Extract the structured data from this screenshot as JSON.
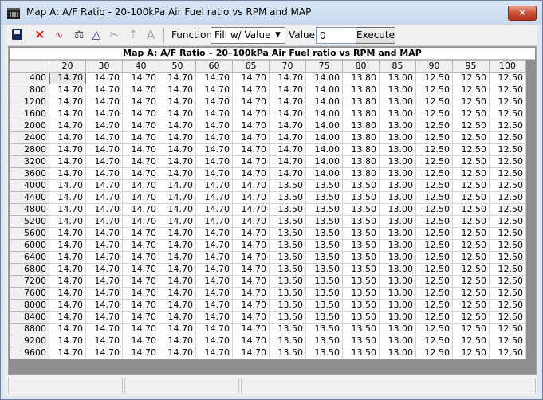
{
  "window": {
    "title": "Map A: A/F Ratio - 20-100kPa Air Fuel ratio vs RPM and MAP",
    "close_label": "✕"
  },
  "toolbar": {
    "function_label": "Function:",
    "function_value": "Fill w/ Value",
    "value_label": "Value:",
    "value_input": "0",
    "execute_label": "Execute"
  },
  "grid": {
    "title": "Map A: A/F Ratio – 20–100kPa Air Fuel ratio vs RPM and MAP",
    "columns": [
      "20",
      "30",
      "40",
      "50",
      "60",
      "65",
      "70",
      "75",
      "80",
      "85",
      "90",
      "95",
      "100"
    ],
    "rows": [
      {
        "rpm": "400",
        "values": [
          "14.70",
          "14.70",
          "14.70",
          "14.70",
          "14.70",
          "14.70",
          "14.70",
          "14.00",
          "13.80",
          "13.00",
          "12.50",
          "12.50",
          "12.50"
        ]
      },
      {
        "rpm": "800",
        "values": [
          "14.70",
          "14.70",
          "14.70",
          "14.70",
          "14.70",
          "14.70",
          "14.70",
          "14.00",
          "13.80",
          "13.00",
          "12.50",
          "12.50",
          "12.50"
        ]
      },
      {
        "rpm": "1200",
        "values": [
          "14.70",
          "14.70",
          "14.70",
          "14.70",
          "14.70",
          "14.70",
          "14.70",
          "14.00",
          "13.80",
          "13.00",
          "12.50",
          "12.50",
          "12.50"
        ]
      },
      {
        "rpm": "1600",
        "values": [
          "14.70",
          "14.70",
          "14.70",
          "14.70",
          "14.70",
          "14.70",
          "14.70",
          "14.00",
          "13.80",
          "13.00",
          "12.50",
          "12.50",
          "12.50"
        ]
      },
      {
        "rpm": "2000",
        "values": [
          "14.70",
          "14.70",
          "14.70",
          "14.70",
          "14.70",
          "14.70",
          "14.70",
          "14.00",
          "13.80",
          "13.00",
          "12.50",
          "12.50",
          "12.50"
        ]
      },
      {
        "rpm": "2400",
        "values": [
          "14.70",
          "14.70",
          "14.70",
          "14.70",
          "14.70",
          "14.70",
          "14.70",
          "14.00",
          "13.80",
          "13.00",
          "12.50",
          "12.50",
          "12.50"
        ]
      },
      {
        "rpm": "2800",
        "values": [
          "14.70",
          "14.70",
          "14.70",
          "14.70",
          "14.70",
          "14.70",
          "14.70",
          "14.00",
          "13.80",
          "13.00",
          "12.50",
          "12.50",
          "12.50"
        ]
      },
      {
        "rpm": "3200",
        "values": [
          "14.70",
          "14.70",
          "14.70",
          "14.70",
          "14.70",
          "14.70",
          "14.70",
          "14.00",
          "13.80",
          "13.00",
          "12.50",
          "12.50",
          "12.50"
        ]
      },
      {
        "rpm": "3600",
        "values": [
          "14.70",
          "14.70",
          "14.70",
          "14.70",
          "14.70",
          "14.70",
          "14.70",
          "14.00",
          "13.80",
          "13.00",
          "12.50",
          "12.50",
          "12.50"
        ]
      },
      {
        "rpm": "4000",
        "values": [
          "14.70",
          "14.70",
          "14.70",
          "14.70",
          "14.70",
          "14.70",
          "13.50",
          "13.50",
          "13.50",
          "13.00",
          "12.50",
          "12.50",
          "12.50"
        ]
      },
      {
        "rpm": "4400",
        "values": [
          "14.70",
          "14.70",
          "14.70",
          "14.70",
          "14.70",
          "14.70",
          "13.50",
          "13.50",
          "13.50",
          "13.00",
          "12.50",
          "12.50",
          "12.50"
        ]
      },
      {
        "rpm": "4800",
        "values": [
          "14.70",
          "14.70",
          "14.70",
          "14.70",
          "14.70",
          "14.70",
          "13.50",
          "13.50",
          "13.50",
          "13.00",
          "12.50",
          "12.50",
          "12.50"
        ]
      },
      {
        "rpm": "5200",
        "values": [
          "14.70",
          "14.70",
          "14.70",
          "14.70",
          "14.70",
          "14.70",
          "13.50",
          "13.50",
          "13.50",
          "13.00",
          "12.50",
          "12.50",
          "12.50"
        ]
      },
      {
        "rpm": "5600",
        "values": [
          "14.70",
          "14.70",
          "14.70",
          "14.70",
          "14.70",
          "14.70",
          "13.50",
          "13.50",
          "13.50",
          "13.00",
          "12.50",
          "12.50",
          "12.50"
        ]
      },
      {
        "rpm": "6000",
        "values": [
          "14.70",
          "14.70",
          "14.70",
          "14.70",
          "14.70",
          "14.70",
          "13.50",
          "13.50",
          "13.50",
          "13.00",
          "12.50",
          "12.50",
          "12.50"
        ]
      },
      {
        "rpm": "6400",
        "values": [
          "14.70",
          "14.70",
          "14.70",
          "14.70",
          "14.70",
          "14.70",
          "13.50",
          "13.50",
          "13.50",
          "13.00",
          "12.50",
          "12.50",
          "12.50"
        ]
      },
      {
        "rpm": "6800",
        "values": [
          "14.70",
          "14.70",
          "14.70",
          "14.70",
          "14.70",
          "14.70",
          "13.50",
          "13.50",
          "13.50",
          "13.00",
          "12.50",
          "12.50",
          "12.50"
        ]
      },
      {
        "rpm": "7200",
        "values": [
          "14.70",
          "14.70",
          "14.70",
          "14.70",
          "14.70",
          "14.70",
          "13.50",
          "13.50",
          "13.50",
          "13.00",
          "12.50",
          "12.50",
          "12.50"
        ]
      },
      {
        "rpm": "7600",
        "values": [
          "14.70",
          "14.70",
          "14.70",
          "14.70",
          "14.70",
          "14.70",
          "13.50",
          "13.50",
          "13.50",
          "13.00",
          "12.50",
          "12.50",
          "12.50"
        ]
      },
      {
        "rpm": "8000",
        "values": [
          "14.70",
          "14.70",
          "14.70",
          "14.70",
          "14.70",
          "14.70",
          "13.50",
          "13.50",
          "13.50",
          "13.00",
          "12.50",
          "12.50",
          "12.50"
        ]
      },
      {
        "rpm": "8400",
        "values": [
          "14.70",
          "14.70",
          "14.70",
          "14.70",
          "14.70",
          "14.70",
          "13.50",
          "13.50",
          "13.50",
          "13.00",
          "12.50",
          "12.50",
          "12.50"
        ]
      },
      {
        "rpm": "8800",
        "values": [
          "14.70",
          "14.70",
          "14.70",
          "14.70",
          "14.70",
          "14.70",
          "13.50",
          "13.50",
          "13.50",
          "13.00",
          "12.50",
          "12.50",
          "12.50"
        ]
      },
      {
        "rpm": "9200",
        "values": [
          "14.70",
          "14.70",
          "14.70",
          "14.70",
          "14.70",
          "14.70",
          "13.50",
          "13.50",
          "13.50",
          "13.00",
          "12.50",
          "12.50",
          "12.50"
        ]
      },
      {
        "rpm": "9600",
        "values": [
          "14.70",
          "14.70",
          "14.70",
          "14.70",
          "14.70",
          "14.70",
          "13.50",
          "13.50",
          "13.50",
          "13.00",
          "12.50",
          "12.50",
          "12.50"
        ]
      }
    ]
  }
}
